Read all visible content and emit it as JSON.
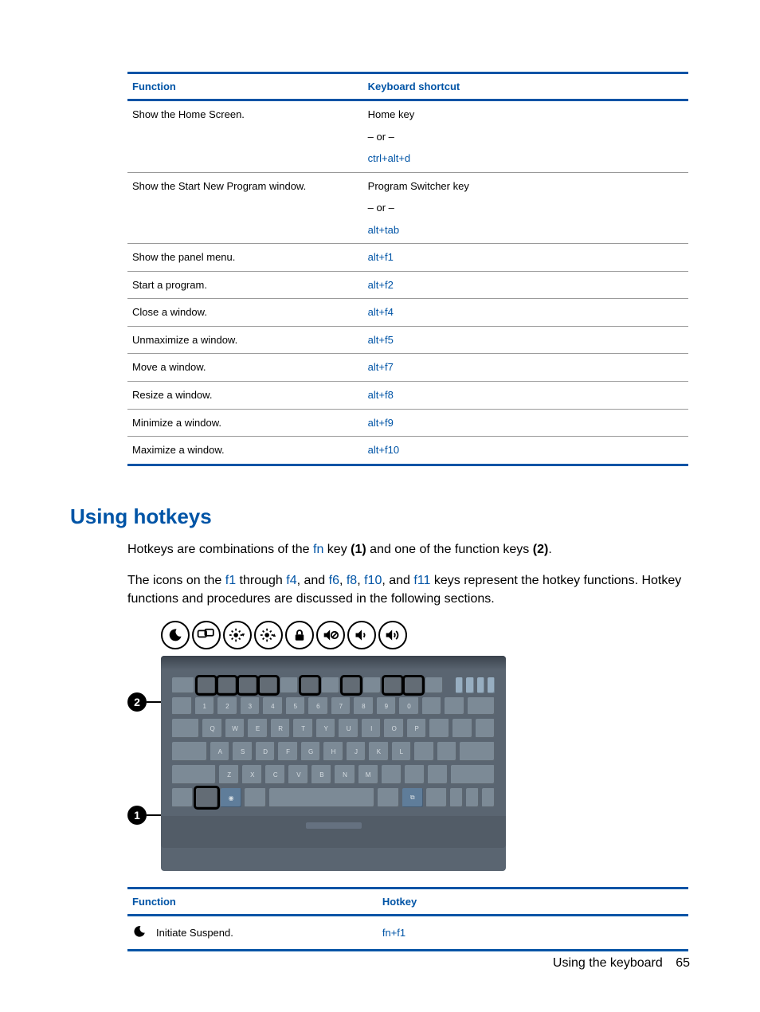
{
  "table1": {
    "headers": {
      "func": "Function",
      "key": "Keyboard shortcut"
    },
    "rows": [
      {
        "func": "Show the Home Screen.",
        "keys": [
          {
            "text": "Home key",
            "blue": false
          },
          {
            "text": "– or –",
            "blue": false
          },
          {
            "text": "ctrl+alt+d",
            "blue": true
          }
        ]
      },
      {
        "func": "Show the Start New Program window.",
        "keys": [
          {
            "text": "Program Switcher key",
            "blue": false
          },
          {
            "text": "– or –",
            "blue": false
          },
          {
            "text": "alt+tab",
            "blue": true
          }
        ]
      },
      {
        "func": "Show the panel menu.",
        "keys": [
          {
            "text": "alt+f1",
            "blue": true
          }
        ]
      },
      {
        "func": "Start a program.",
        "keys": [
          {
            "text": "alt+f2",
            "blue": true
          }
        ]
      },
      {
        "func": "Close a window.",
        "keys": [
          {
            "text": "alt+f4",
            "blue": true
          }
        ]
      },
      {
        "func": "Unmaximize a window.",
        "keys": [
          {
            "text": "alt+f5",
            "blue": true
          }
        ]
      },
      {
        "func": "Move a window.",
        "keys": [
          {
            "text": "alt+f7",
            "blue": true
          }
        ]
      },
      {
        "func": "Resize a window.",
        "keys": [
          {
            "text": "alt+f8",
            "blue": true
          }
        ]
      },
      {
        "func": "Minimize a window.",
        "keys": [
          {
            "text": "alt+f9",
            "blue": true
          }
        ]
      },
      {
        "func": "Maximize a window.",
        "keys": [
          {
            "text": "alt+f10",
            "blue": true
          }
        ]
      }
    ]
  },
  "section_heading": "Using hotkeys",
  "para1": {
    "pre": "Hotkeys are combinations of the ",
    "fn": "fn",
    "mid": " key ",
    "b1": "(1)",
    "mid2": " and one of the function keys ",
    "b2": "(2)",
    "post": "."
  },
  "para2": {
    "t0": "The icons on the ",
    "f1": "f1",
    "t1": " through ",
    "f4": "f4",
    "t2": ", and ",
    "f6": "f6",
    "t3": ", ",
    "f8": "f8",
    "t4": ", ",
    "f10": "f10",
    "t5": ", and ",
    "f11": "f11",
    "t6": " keys represent the hotkey functions. Hotkey functions and procedures are discussed in the following sections."
  },
  "callouts": {
    "c1": "1",
    "c2": "2"
  },
  "table2": {
    "headers": {
      "func": "Function",
      "key": "Hotkey"
    },
    "rows": [
      {
        "func": "Initiate Suspend.",
        "key": "fn+f1"
      }
    ]
  },
  "footer": {
    "label": "Using the keyboard",
    "page": "65"
  }
}
